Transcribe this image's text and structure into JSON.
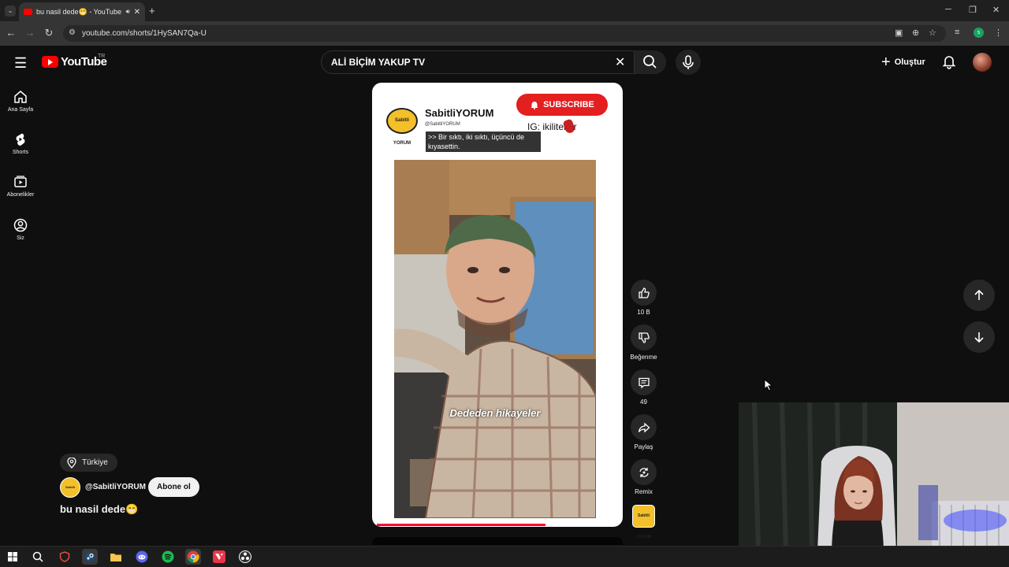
{
  "browser": {
    "tab_title": "bu nasil dede😁 - YouTube",
    "tab_sound_icon": "speaker-icon",
    "url": "youtube.com/shorts/1HySAN7Qa-U"
  },
  "header": {
    "logo_text": "YouTube",
    "country_code": "TR",
    "search_value": "ALİ BİÇİM YAKUP TV",
    "create_label": "Oluştur"
  },
  "guide": {
    "items": [
      {
        "label": "Ana Sayfa",
        "icon": "home-icon"
      },
      {
        "label": "Shorts",
        "icon": "shorts-icon"
      },
      {
        "label": "Abonelikler",
        "icon": "subscriptions-icon"
      },
      {
        "label": "Siz",
        "icon": "you-icon"
      }
    ]
  },
  "short": {
    "overlay_channel": "SabitliYORUM",
    "overlay_handle": "@SabitliYORUM",
    "overlay_logo_text": "Sabitli YORUM",
    "subscribe_overlay": "SUBSCRIBE",
    "ig_text": "IG: ikilitekrir",
    "caption": ">> Bir sıktı, iki sıktı, üçüncü de kıyasettin.",
    "video_subtitle": "Dededen hikayeler",
    "progress": 0.7
  },
  "actions": {
    "like_count": "10 B",
    "dislike_label": "Beğenme",
    "comment_count": "49",
    "share_label": "Paylaş",
    "remix_label": "Remix"
  },
  "info": {
    "location": "Türkiye",
    "handle": "@SabitliYORUM",
    "subscribe_label": "Abone ol",
    "title": "bu nasil dede😁"
  },
  "colors": {
    "accent_red": "#ff0000",
    "subscribe_red": "#e41f1f",
    "progress": "#ff0033"
  }
}
